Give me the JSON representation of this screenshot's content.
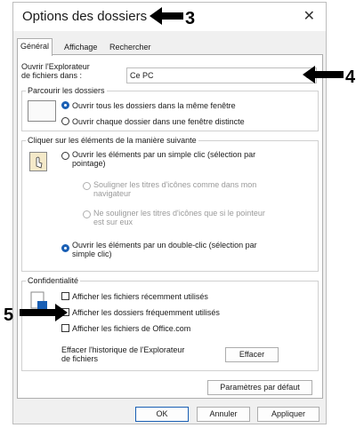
{
  "title": "Options des dossiers",
  "close_glyph": "✕",
  "tabs": [
    "Général",
    "Affichage",
    "Rechercher"
  ],
  "explorer": {
    "label_line1": "Ouvrir l'Explorateur",
    "label_line2": "de fichiers dans :",
    "value": "Ce PC",
    "chevron": "⌄"
  },
  "browse": {
    "legend": "Parcourir les dossiers",
    "option1": "Ouvrir tous les dossiers dans la même fenêtre",
    "option2": "Ouvrir chaque dossier dans une fenêtre distincte",
    "selected": 1
  },
  "click": {
    "legend": "Cliquer sur les éléments de la manière suivante",
    "single_line1": "Ouvrir les éléments par un simple clic (sélection par",
    "single_line2": "pointage)",
    "sub1_line1": "Souligner les titres d'icônes comme dans mon",
    "sub1_line2": "navigateur",
    "sub2_line1": "Ne souligner les titres d'icônes que si le pointeur",
    "sub2_line2": "est sur eux",
    "double_line1": "Ouvrir les éléments par un double-clic (sélection par",
    "double_line2": "simple clic)",
    "selected": 2
  },
  "privacy": {
    "legend": "Confidentialité",
    "check1": "Afficher les fichiers récemment utilisés",
    "check2": "Afficher les dossiers fréquemment utilisés",
    "check3": "Afficher les fichiers de Office.com",
    "clear_line1": "Effacer l'historique de l'Explorateur",
    "clear_line2": "de fichiers",
    "clear_button": "Effacer"
  },
  "defaults_button": "Paramètres par défaut",
  "footer": {
    "ok": "OK",
    "cancel": "Annuler",
    "apply": "Appliquer"
  },
  "annotations": {
    "n3": "3",
    "n4": "4",
    "n5": "5"
  },
  "colors": {
    "accent": "#1a5fb4",
    "dialog_bg": "#f0f0f0"
  }
}
